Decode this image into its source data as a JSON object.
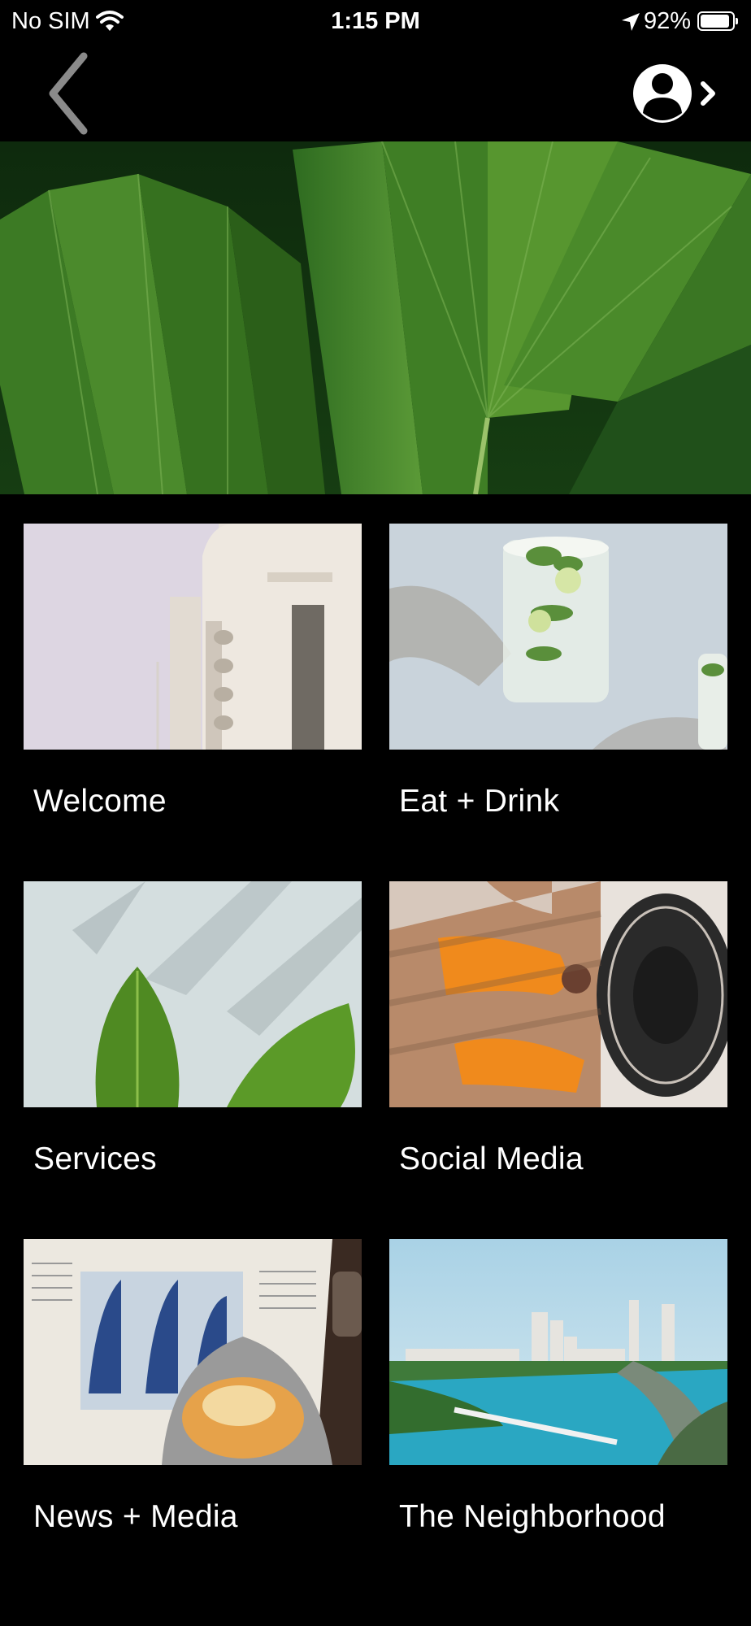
{
  "status_bar": {
    "carrier": "No SIM",
    "time": "1:15 PM",
    "battery_percent": "92%",
    "battery_level": 0.92
  },
  "nav": {
    "back_icon": "chevron-left-icon",
    "profile_icon": "user-profile-icon"
  },
  "hero": {
    "image": "tropical-palm-leaves"
  },
  "tiles": [
    {
      "label": "Welcome",
      "image": "art-deco-hotel-facade"
    },
    {
      "label": "Eat + Drink",
      "image": "mojito-glass"
    },
    {
      "label": "Services",
      "image": "leaves-on-wall"
    },
    {
      "label": "Social Media",
      "image": "sunbathing-woman-hat"
    },
    {
      "label": "News + Media",
      "image": "newspaper-with-pastry"
    },
    {
      "label": "The Neighborhood",
      "image": "city-waterfront-aerial"
    }
  ],
  "colors": {
    "background": "#000000",
    "text": "#ffffff"
  }
}
